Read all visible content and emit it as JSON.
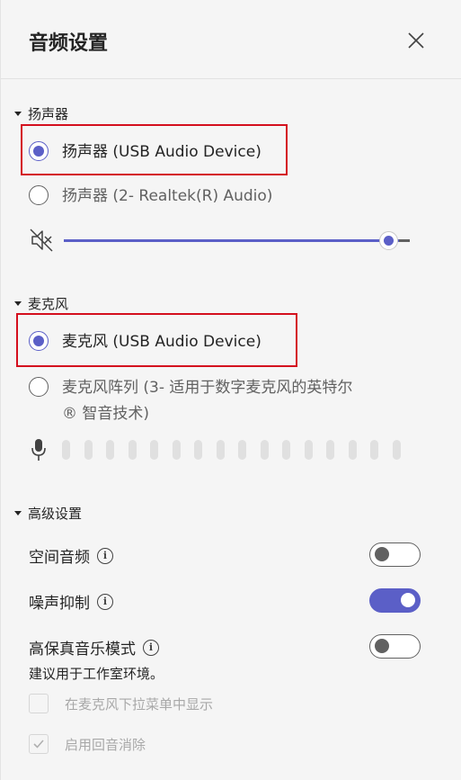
{
  "header": {
    "title": "音频设置",
    "close_icon": "close-icon"
  },
  "speaker": {
    "section_label": "扬声器",
    "options": [
      {
        "label": "扬声器 (USB Audio Device)",
        "selected": true
      },
      {
        "label": "扬声器 (2- Realtek(R) Audio)",
        "selected": false
      }
    ],
    "volume_icon": "speaker-mute-icon",
    "volume_level": 0.96
  },
  "microphone": {
    "section_label": "麦克风",
    "options": [
      {
        "label": "麦克风 (USB Audio Device)",
        "selected": true
      },
      {
        "label_line1": "麦克风阵列 (3- 适用于数字麦克风的英特尔",
        "label_line2": "® 智音技术)",
        "selected": false
      }
    ],
    "mic_icon": "microphone-icon",
    "level_bars": 16
  },
  "advanced": {
    "section_label": "高级设置",
    "spatial_audio": {
      "label": "空间音频",
      "on": false
    },
    "noise_suppression": {
      "label": "噪声抑制",
      "on": true
    },
    "hifi_music": {
      "label": "高保真音乐模式",
      "on": false,
      "note": "建议用于工作室环境。"
    },
    "show_in_mic_dropdown": {
      "label": "在麦克风下拉菜单中显示",
      "checked": false,
      "disabled": true
    },
    "echo_cancellation": {
      "label": "启用回音消除",
      "checked": true,
      "disabled": true
    }
  },
  "colors": {
    "accent": "#5b5fc7",
    "highlight_border": "#d40f1e"
  }
}
